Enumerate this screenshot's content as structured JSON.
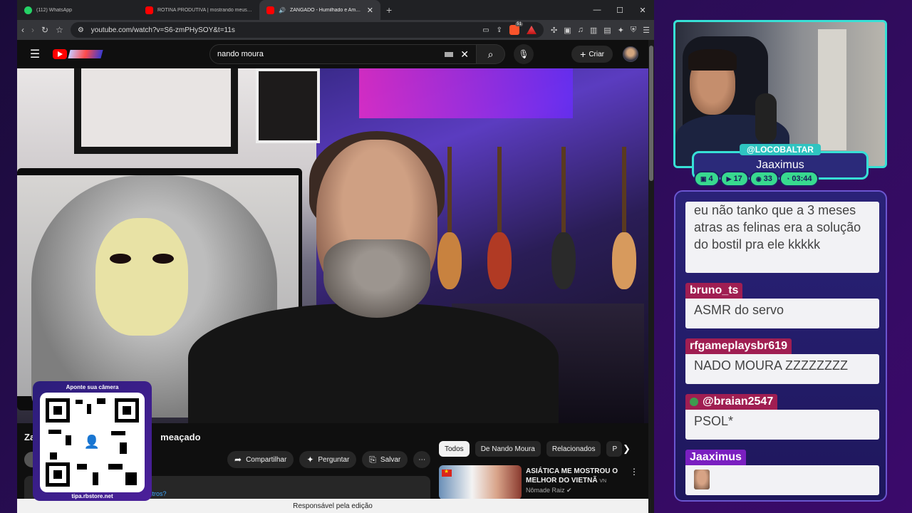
{
  "browser": {
    "tabs": [
      {
        "title": "(112) WhatsApp",
        "icon": "whatsapp-icon"
      },
      {
        "title": "ROTINA PRODUTIVA | mostrando meus hábitos",
        "icon": "youtube-icon"
      },
      {
        "title": "ZANGADO - Humilhado e Ameaçado",
        "icon": "youtube-icon",
        "active": true
      }
    ],
    "new_tab": "+",
    "url": "youtube.com/watch?v=S6-zmPHySOY&t=11s",
    "brave_badge": "51",
    "status_text": "Responsável pela edição"
  },
  "youtube": {
    "search_value": "nando moura",
    "create_label": "Criar",
    "video_title_visible": "Za",
    "video_title_tail": "meaçado",
    "actions": {
      "share": "Compartilhar",
      "ask": "Perguntar",
      "save": "Salvar",
      "more": "⋯"
    },
    "desc_fragment": "estros?",
    "chips": [
      "Todos",
      "De Nando Moura",
      "Relacionados",
      "P"
    ],
    "recommendation": {
      "title": "ASIÁTICA ME MOSTROU O MELHOR DO VIETNÃ",
      "suffix": "VN",
      "channel": "Nômade Raiz",
      "verified": "✔"
    }
  },
  "qr_overlay": {
    "top_text": "Aponte sua câmera",
    "bottom_text": "tipa.rbstore.net"
  },
  "stream_overlay": {
    "handle": "@LOCOBALTAR",
    "name": "Jaaximus",
    "stats": [
      {
        "icon": "twitch-icon",
        "value": "4"
      },
      {
        "icon": "youtube-icon",
        "value": "17"
      },
      {
        "icon": "kick-icon",
        "value": "33"
      },
      {
        "icon": "clock-icon",
        "value": "03:44"
      }
    ]
  },
  "chat": {
    "messages": [
      {
        "user": "",
        "text": "eu não tanko que a 3 meses atras as felinas era a solução do bostil pra ele kkkkk"
      },
      {
        "user": "bruno_ts",
        "text": "ASMR do servo"
      },
      {
        "user": "rfgameplaysbr619",
        "text": "NADO MOURA ZZZZZZZZ"
      },
      {
        "user": "@braian2547",
        "text": "PSOL*"
      },
      {
        "user": "Jaaximus",
        "text": ""
      }
    ]
  },
  "colors": {
    "accent_teal": "#37e0d6",
    "chat_user_red": "#a01e52",
    "chat_user_purple": "#7a1fc0",
    "stat_green": "#38d98f"
  }
}
